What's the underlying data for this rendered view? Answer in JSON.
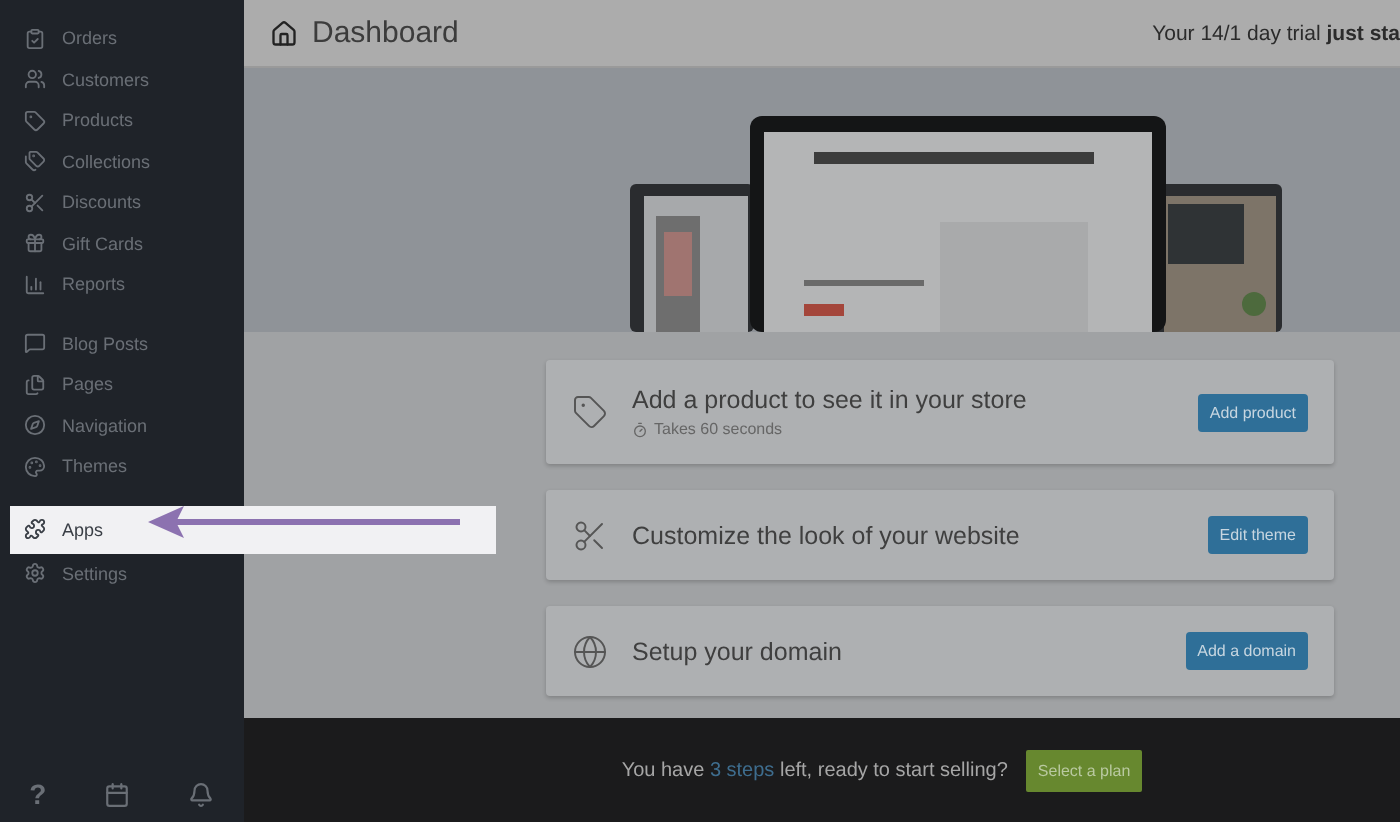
{
  "sidebar": {
    "groups": [
      [
        {
          "label": "Orders",
          "selected": false
        },
        {
          "label": "Customers",
          "selected": false
        },
        {
          "label": "Products",
          "selected": false
        },
        {
          "label": "Collections",
          "selected": false
        },
        {
          "label": "Discounts",
          "selected": false
        },
        {
          "label": "Gift Cards",
          "selected": false
        },
        {
          "label": "Reports",
          "selected": false
        }
      ],
      [
        {
          "label": "Blog Posts",
          "selected": false
        },
        {
          "label": "Pages",
          "selected": false
        },
        {
          "label": "Navigation",
          "selected": false
        },
        {
          "label": "Themes",
          "selected": false
        }
      ],
      [
        {
          "label": "Apps",
          "selected": true
        },
        {
          "label": "Settings",
          "selected": false
        }
      ]
    ],
    "footer_icons": [
      "?"
    ]
  },
  "header": {
    "title": "Dashboard",
    "trial_text": "Your 14/1 day trial ",
    "trial_bold": "just sta"
  },
  "tasks": [
    {
      "title": "Add a product to see it in your store",
      "subtitle": "Takes 60 seconds",
      "button": "Add product"
    },
    {
      "title": "Customize the look of your website",
      "button": "Edit theme"
    },
    {
      "title": "Setup your domain",
      "button": "Add a domain"
    }
  ],
  "bottom_bar": {
    "before": "You have ",
    "link": "3 steps",
    "after": " left, ready to start selling?",
    "button": "Select a plan"
  }
}
